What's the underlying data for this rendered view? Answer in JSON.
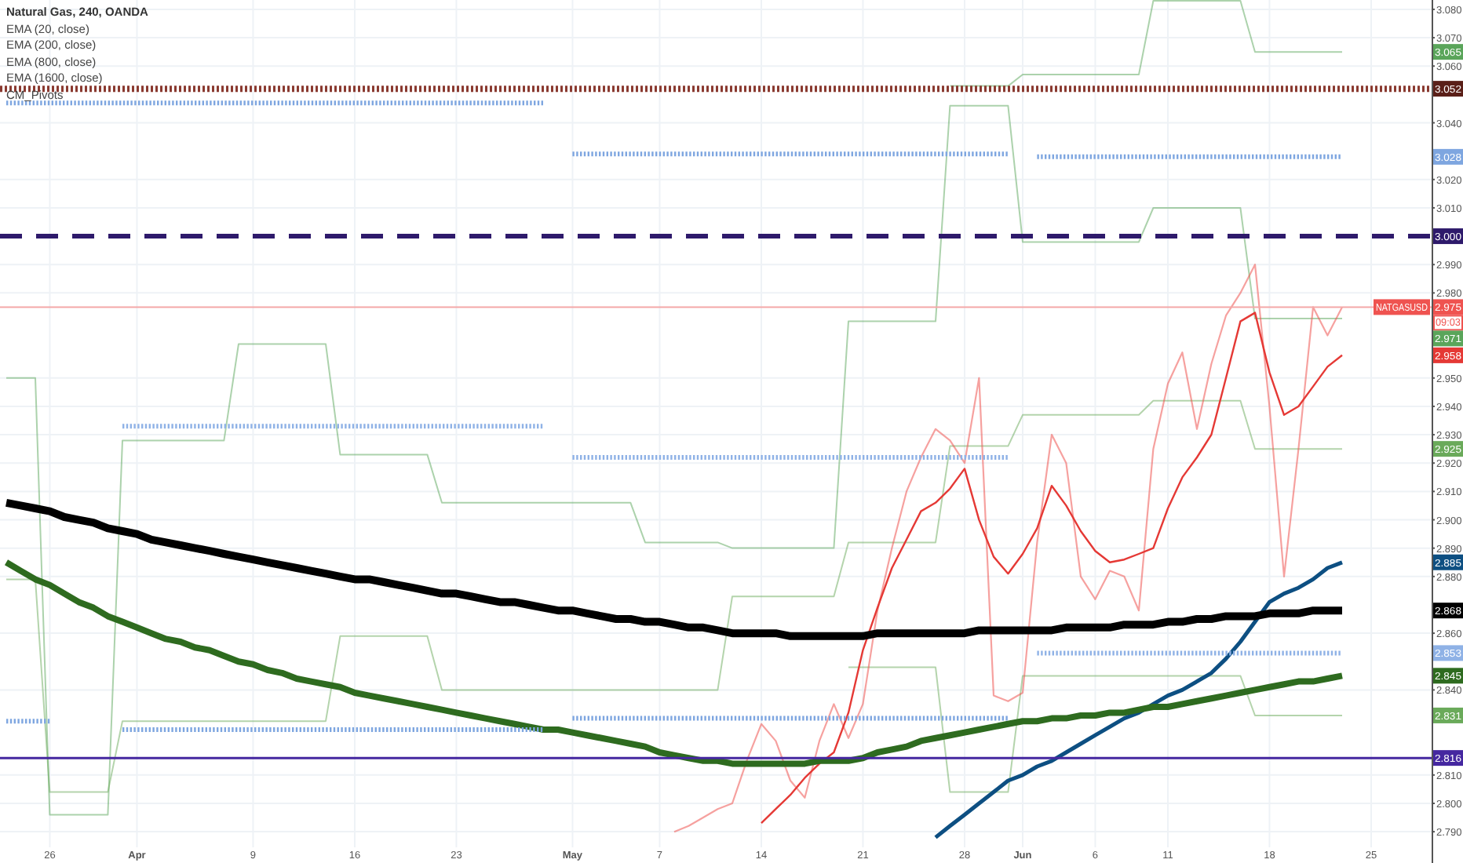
{
  "chart_data": {
    "type": "line",
    "grid": true,
    "title": "Natural Gas, 240, OANDA",
    "ylim": [
      2.7845,
      3.0833
    ],
    "categories": [
      null,
      null,
      null,
      "26",
      null,
      null,
      null,
      null,
      null,
      "Apr",
      null,
      null,
      null,
      null,
      null,
      null,
      null,
      "9",
      null,
      null,
      null,
      null,
      null,
      null,
      "16",
      null,
      null,
      null,
      null,
      null,
      null,
      "23",
      null,
      null,
      null,
      null,
      null,
      null,
      null,
      "May",
      null,
      null,
      null,
      null,
      null,
      "7",
      null,
      null,
      null,
      null,
      null,
      null,
      "14",
      null,
      null,
      null,
      null,
      null,
      null,
      "21",
      null,
      null,
      null,
      null,
      null,
      null,
      "28",
      null,
      null,
      null,
      "Jun",
      null,
      null,
      null,
      null,
      "6",
      null,
      null,
      null,
      null,
      "11",
      null,
      null,
      null,
      null,
      null,
      null,
      "18",
      null,
      null,
      null,
      null,
      null,
      null,
      "25"
    ],
    "yticks": [
      {
        "value": 3.08,
        "label": "3.080"
      },
      {
        "value": 3.07,
        "label": "3.070"
      },
      {
        "value": 3.06,
        "label": "3.060"
      },
      {
        "value": 3.04,
        "label": "3.040"
      },
      {
        "value": 3.02,
        "label": "3.020"
      },
      {
        "value": 3.01,
        "label": "3.010"
      },
      {
        "value": 2.99,
        "label": "2.990"
      },
      {
        "value": 2.98,
        "label": "2.980"
      },
      {
        "value": 2.95,
        "label": "2.950"
      },
      {
        "value": 2.94,
        "label": "2.940"
      },
      {
        "value": 2.93,
        "label": "2.930"
      },
      {
        "value": 2.92,
        "label": "2.920"
      },
      {
        "value": 2.91,
        "label": "2.910"
      },
      {
        "value": 2.9,
        "label": "2.900"
      },
      {
        "value": 2.89,
        "label": "2.890"
      },
      {
        "value": 2.88,
        "label": "2.880"
      },
      {
        "value": 2.86,
        "label": "2.860"
      },
      {
        "value": 2.84,
        "label": "2.840"
      },
      {
        "value": 2.81,
        "label": "2.810"
      },
      {
        "value": 2.8,
        "label": "2.800"
      },
      {
        "value": 2.79,
        "label": "2.790"
      }
    ],
    "series": [
      {
        "color": "#5aa55a",
        "values": [
          2.95,
          2.95,
          2.95,
          2.796,
          2.796,
          2.796,
          2.796,
          2.796,
          2.928,
          2.928,
          2.928,
          2.928,
          2.928,
          2.928,
          2.928,
          2.928,
          2.962,
          2.962,
          2.962,
          2.962,
          2.962,
          2.962,
          2.962,
          2.923,
          2.923,
          2.923,
          2.923,
          2.923,
          2.923,
          2.923,
          2.906,
          2.906,
          2.906,
          2.906,
          2.906,
          2.906,
          2.906,
          2.906,
          2.906,
          2.906,
          2.906,
          2.906,
          2.906,
          2.906,
          2.892,
          2.892,
          2.892,
          2.892,
          2.892,
          2.892,
          2.89,
          2.89,
          2.89,
          2.89,
          2.89,
          2.89,
          2.89,
          2.89,
          2.97,
          2.97,
          2.97,
          2.97,
          2.97,
          2.97,
          2.97,
          3.046,
          3.046,
          3.046,
          3.046,
          3.046,
          2.998,
          2.998,
          2.998,
          2.998,
          2.998,
          2.998,
          2.998,
          2.998,
          2.998,
          3.01,
          3.01,
          3.01,
          3.01,
          3.01,
          3.01,
          3.01,
          2.971,
          2.971,
          2.971,
          2.971,
          2.971,
          2.971,
          2.971,
          null,
          null
        ]
      },
      {
        "color": "#6aaa5a",
        "values": [
          2.879,
          2.879,
          2.879,
          2.804,
          2.804,
          2.804,
          2.804,
          2.804,
          2.829,
          2.829,
          2.829,
          2.829,
          2.829,
          2.829,
          2.829,
          2.829,
          2.829,
          2.829,
          2.829,
          2.829,
          2.829,
          2.829,
          2.829,
          2.859,
          2.859,
          2.859,
          2.859,
          2.859,
          2.859,
          2.859,
          2.84,
          2.84,
          2.84,
          2.84,
          2.84,
          2.84,
          2.84,
          2.84,
          2.84,
          2.84,
          2.84,
          2.84,
          2.84,
          2.84,
          2.84,
          2.84,
          2.84,
          2.84,
          2.84,
          2.84,
          2.873,
          2.873,
          2.873,
          2.873,
          2.873,
          2.873,
          2.873,
          2.873,
          2.892,
          2.892,
          2.892,
          2.892,
          2.892,
          2.892,
          2.892,
          2.926,
          2.926,
          2.926,
          2.926,
          2.926,
          2.937,
          2.937,
          2.937,
          2.937,
          2.937,
          2.937,
          2.937,
          2.937,
          2.937,
          2.942,
          2.942,
          2.942,
          2.942,
          2.942,
          2.942,
          2.942,
          2.925,
          2.925,
          2.925,
          2.925,
          2.925,
          2.925,
          2.925,
          null,
          null
        ]
      },
      {
        "color": "#6aaa5a",
        "values": [
          null,
          null,
          null,
          null,
          null,
          null,
          null,
          null,
          null,
          null,
          null,
          null,
          null,
          null,
          null,
          null,
          null,
          null,
          null,
          null,
          null,
          null,
          null,
          null,
          null,
          null,
          null,
          null,
          null,
          null,
          null,
          null,
          null,
          null,
          null,
          null,
          null,
          null,
          null,
          null,
          null,
          null,
          null,
          null,
          null,
          null,
          null,
          null,
          null,
          null,
          null,
          null,
          null,
          null,
          null,
          null,
          null,
          null,
          2.848,
          2.848,
          2.848,
          2.848,
          2.848,
          2.848,
          2.848,
          2.804,
          2.804,
          2.804,
          2.804,
          2.804,
          2.845,
          2.845,
          2.845,
          2.845,
          2.845,
          2.845,
          2.845,
          2.845,
          2.845,
          2.845,
          2.845,
          2.845,
          2.845,
          2.845,
          2.845,
          2.845,
          2.831,
          2.831,
          2.831,
          2.831,
          2.831,
          2.831,
          2.831,
          null,
          null
        ]
      },
      {
        "color": "#5aa55a",
        "values": [
          null,
          null,
          null,
          null,
          null,
          null,
          null,
          null,
          null,
          null,
          null,
          null,
          null,
          null,
          null,
          null,
          null,
          null,
          null,
          null,
          null,
          null,
          null,
          null,
          null,
          null,
          null,
          null,
          null,
          null,
          null,
          null,
          null,
          null,
          null,
          null,
          null,
          null,
          null,
          null,
          null,
          null,
          null,
          null,
          null,
          null,
          null,
          null,
          null,
          null,
          null,
          null,
          null,
          null,
          null,
          null,
          null,
          null,
          null,
          null,
          null,
          null,
          null,
          null,
          null,
          3.053,
          3.053,
          3.053,
          3.053,
          3.053,
          3.057,
          3.057,
          3.057,
          3.057,
          3.057,
          3.057,
          3.057,
          3.057,
          3.057,
          3.083,
          3.083,
          3.083,
          3.083,
          3.083,
          3.083,
          3.083,
          3.065,
          3.065,
          3.065,
          3.065,
          3.065,
          3.065,
          3.065,
          null,
          null
        ]
      },
      {
        "color": "#ef5350",
        "values": [
          null,
          null,
          null,
          null,
          null,
          null,
          null,
          null,
          null,
          null,
          null,
          null,
          null,
          null,
          null,
          null,
          null,
          null,
          null,
          null,
          null,
          null,
          null,
          null,
          null,
          null,
          null,
          null,
          null,
          null,
          null,
          null,
          null,
          null,
          null,
          null,
          null,
          null,
          null,
          null,
          null,
          null,
          null,
          null,
          null,
          null,
          2.79,
          2.792,
          2.795,
          2.798,
          2.8,
          2.815,
          2.828,
          2.822,
          2.808,
          2.802,
          2.822,
          2.835,
          2.823,
          2.835,
          2.868,
          2.89,
          2.91,
          2.922,
          2.932,
          2.928,
          2.92,
          2.95,
          2.838,
          2.836,
          2.839,
          2.892,
          2.93,
          2.92,
          2.88,
          2.872,
          2.882,
          2.88,
          2.868,
          2.925,
          2.948,
          2.959,
          2.932,
          2.955,
          2.972,
          2.98,
          2.99,
          2.94,
          2.88,
          2.925,
          2.975,
          2.965,
          2.975,
          null,
          null
        ]
      },
      {
        "name": "EMA (20, close)",
        "color": "#e53935",
        "values": [
          null,
          null,
          null,
          null,
          null,
          null,
          null,
          null,
          null,
          null,
          null,
          null,
          null,
          null,
          null,
          null,
          null,
          null,
          null,
          null,
          null,
          null,
          null,
          null,
          null,
          null,
          null,
          null,
          null,
          null,
          null,
          null,
          null,
          null,
          null,
          null,
          null,
          null,
          null,
          null,
          null,
          null,
          null,
          null,
          null,
          null,
          null,
          null,
          null,
          null,
          null,
          null,
          2.793,
          2.798,
          2.803,
          2.809,
          2.814,
          2.818,
          2.832,
          2.854,
          2.869,
          2.883,
          2.893,
          2.903,
          2.906,
          2.911,
          2.918,
          2.9,
          2.887,
          2.881,
          2.888,
          2.897,
          2.912,
          2.905,
          2.896,
          2.889,
          2.885,
          2.886,
          2.888,
          2.89,
          2.904,
          2.915,
          2.922,
          2.93,
          2.95,
          2.97,
          2.973,
          2.952,
          2.937,
          2.94,
          2.947,
          2.954,
          2.958,
          null,
          null
        ]
      },
      {
        "name": "EMA (200, close)",
        "color": "#0d4f82",
        "values": [
          null,
          null,
          null,
          null,
          null,
          null,
          null,
          null,
          null,
          null,
          null,
          null,
          null,
          null,
          null,
          null,
          null,
          null,
          null,
          null,
          null,
          null,
          null,
          null,
          null,
          null,
          null,
          null,
          null,
          null,
          null,
          null,
          null,
          null,
          null,
          null,
          null,
          null,
          null,
          null,
          null,
          null,
          null,
          null,
          null,
          null,
          null,
          null,
          null,
          null,
          null,
          null,
          null,
          null,
          null,
          null,
          null,
          null,
          null,
          null,
          null,
          null,
          null,
          null,
          2.788,
          2.792,
          2.796,
          2.8,
          2.804,
          2.808,
          2.81,
          2.813,
          2.815,
          2.818,
          2.821,
          2.824,
          2.827,
          2.83,
          2.832,
          2.835,
          2.838,
          2.84,
          2.843,
          2.846,
          2.851,
          2.857,
          2.864,
          2.871,
          2.874,
          2.876,
          2.879,
          2.883,
          2.885,
          null,
          null
        ]
      },
      {
        "name": "EMA (800, close)",
        "color": "#2e6b1f",
        "values": [
          2.885,
          2.882,
          2.879,
          2.877,
          2.874,
          2.871,
          2.869,
          2.866,
          2.864,
          2.862,
          2.86,
          2.858,
          2.857,
          2.855,
          2.854,
          2.852,
          2.85,
          2.849,
          2.847,
          2.846,
          2.844,
          2.843,
          2.842,
          2.841,
          2.839,
          2.838,
          2.837,
          2.836,
          2.835,
          2.834,
          2.833,
          2.832,
          2.831,
          2.83,
          2.829,
          2.828,
          2.827,
          2.826,
          2.826,
          2.825,
          2.824,
          2.823,
          2.822,
          2.821,
          2.82,
          2.818,
          2.817,
          2.816,
          2.815,
          2.815,
          2.814,
          2.814,
          2.814,
          2.814,
          2.814,
          2.814,
          2.815,
          2.815,
          2.815,
          2.816,
          2.818,
          2.819,
          2.82,
          2.822,
          2.823,
          2.824,
          2.825,
          2.826,
          2.827,
          2.828,
          2.829,
          2.829,
          2.83,
          2.83,
          2.831,
          2.831,
          2.832,
          2.832,
          2.833,
          2.834,
          2.834,
          2.835,
          2.836,
          2.837,
          2.838,
          2.839,
          2.84,
          2.841,
          2.842,
          2.843,
          2.843,
          2.844,
          2.845,
          null,
          null
        ]
      },
      {
        "name": "EMA (1600, close)",
        "color": "#000000",
        "values": [
          2.906,
          2.905,
          2.904,
          2.903,
          2.901,
          2.9,
          2.899,
          2.897,
          2.896,
          2.895,
          2.893,
          2.892,
          2.891,
          2.89,
          2.889,
          2.888,
          2.887,
          2.886,
          2.885,
          2.884,
          2.883,
          2.882,
          2.881,
          2.88,
          2.879,
          2.879,
          2.878,
          2.877,
          2.876,
          2.875,
          2.874,
          2.874,
          2.873,
          2.872,
          2.871,
          2.871,
          2.87,
          2.869,
          2.868,
          2.868,
          2.867,
          2.866,
          2.865,
          2.865,
          2.864,
          2.864,
          2.863,
          2.862,
          2.862,
          2.861,
          2.86,
          2.86,
          2.86,
          2.86,
          2.859,
          2.859,
          2.859,
          2.859,
          2.859,
          2.859,
          2.86,
          2.86,
          2.86,
          2.86,
          2.86,
          2.86,
          2.86,
          2.861,
          2.861,
          2.861,
          2.861,
          2.861,
          2.861,
          2.862,
          2.862,
          2.862,
          2.862,
          2.863,
          2.863,
          2.863,
          2.864,
          2.864,
          2.865,
          2.865,
          2.866,
          2.866,
          2.866,
          2.867,
          2.867,
          2.867,
          2.868,
          2.868,
          2.868,
          null,
          null
        ]
      },
      {
        "name": "CM_Pivots",
        "color": "#7ea6e0",
        "line_style": "dotted",
        "values": [
          3.047,
          3.047,
          3.047,
          3.047,
          3.047,
          3.047,
          3.047,
          3.047,
          3.047,
          3.047,
          3.047,
          3.047,
          3.047,
          3.047,
          3.047,
          3.047,
          3.047,
          3.047,
          3.047,
          3.047,
          3.047,
          3.047,
          3.047,
          3.047,
          3.047,
          3.047,
          3.047,
          3.047,
          3.047,
          3.047,
          3.047,
          3.047,
          3.047,
          3.047,
          3.047,
          3.047,
          3.047,
          3.047,
          null,
          3.029,
          3.029,
          3.029,
          3.029,
          3.029,
          3.029,
          3.029,
          3.029,
          3.029,
          3.029,
          3.029,
          3.029,
          3.029,
          3.029,
          3.029,
          3.029,
          3.029,
          3.029,
          3.029,
          3.029,
          3.029,
          3.029,
          3.029,
          3.029,
          3.029,
          3.029,
          3.029,
          3.029,
          3.029,
          3.029,
          3.029,
          null,
          3.028,
          3.028,
          3.028,
          3.028,
          3.028,
          3.028,
          3.028,
          3.028,
          3.028,
          3.028,
          3.028,
          3.028,
          3.028,
          3.028,
          3.028,
          3.028,
          3.028,
          3.028,
          3.028,
          3.028,
          3.028,
          3.028,
          null,
          null
        ]
      },
      {
        "color": "#8fb2e6",
        "line_style": "dotted",
        "values": [
          null,
          null,
          null,
          null,
          null,
          null,
          null,
          null,
          2.933,
          2.933,
          2.933,
          2.933,
          2.933,
          2.933,
          2.933,
          2.933,
          2.933,
          2.933,
          2.933,
          2.933,
          2.933,
          2.933,
          2.933,
          2.933,
          2.933,
          2.933,
          2.933,
          2.933,
          2.933,
          2.933,
          2.933,
          2.933,
          2.933,
          2.933,
          2.933,
          2.933,
          2.933,
          2.933,
          null,
          2.922,
          2.922,
          2.922,
          2.922,
          2.922,
          2.922,
          2.922,
          2.922,
          2.922,
          2.922,
          2.922,
          2.922,
          2.922,
          2.922,
          2.922,
          2.922,
          2.922,
          2.922,
          2.922,
          2.922,
          2.922,
          2.922,
          2.922,
          2.922,
          2.922,
          2.922,
          2.922,
          2.922,
          2.922,
          2.922,
          2.922,
          null,
          2.853,
          2.853,
          2.853,
          2.853,
          2.853,
          2.853,
          2.853,
          2.853,
          2.853,
          2.853,
          2.853,
          2.853,
          2.853,
          2.853,
          2.853,
          2.853,
          2.853,
          2.853,
          2.853,
          2.853,
          2.853,
          2.853,
          null,
          null
        ]
      },
      {
        "color": "#7ea6e0",
        "line_style": "dotted",
        "values": [
          2.829,
          2.829,
          2.829,
          2.829,
          null,
          null,
          null,
          null,
          2.826,
          2.826,
          2.826,
          2.826,
          2.826,
          2.826,
          2.826,
          2.826,
          2.826,
          2.826,
          2.826,
          2.826,
          2.826,
          2.826,
          2.826,
          2.826,
          2.826,
          2.826,
          2.826,
          2.826,
          2.826,
          2.826,
          2.826,
          2.826,
          2.826,
          2.826,
          2.826,
          2.826,
          2.826,
          2.826,
          null,
          2.83,
          2.83,
          2.83,
          2.83,
          2.83,
          2.83,
          2.83,
          2.83,
          2.83,
          2.83,
          2.83,
          2.83,
          2.83,
          2.83,
          2.83,
          2.83,
          2.83,
          2.83,
          2.83,
          2.83,
          2.83,
          2.83,
          2.83,
          2.83,
          2.83,
          2.83,
          2.83,
          2.83,
          2.83,
          2.83,
          2.83,
          null,
          null,
          null,
          null,
          null,
          null,
          null,
          null,
          null,
          null,
          null,
          null,
          null,
          null,
          null,
          null,
          null,
          null,
          null,
          null,
          null,
          null,
          null,
          null,
          null
        ]
      }
    ],
    "ref_lines": [
      {
        "axis": "y",
        "value": 3.052,
        "label": "3.052"
      },
      {
        "axis": "y",
        "value": 3.0,
        "label": "3.000"
      },
      {
        "axis": "y",
        "value": 2.975,
        "label": "2.975"
      },
      {
        "axis": "y",
        "value": 2.816,
        "label": "2.816"
      }
    ],
    "annotations": [
      "3.065",
      "3.028",
      "2.971",
      "2.958",
      "2.925",
      "2.885",
      "2.868",
      "2.853",
      "2.845",
      "2.831"
    ]
  },
  "symbol_tag": "NATGASUSD",
  "countdown": "09:03"
}
